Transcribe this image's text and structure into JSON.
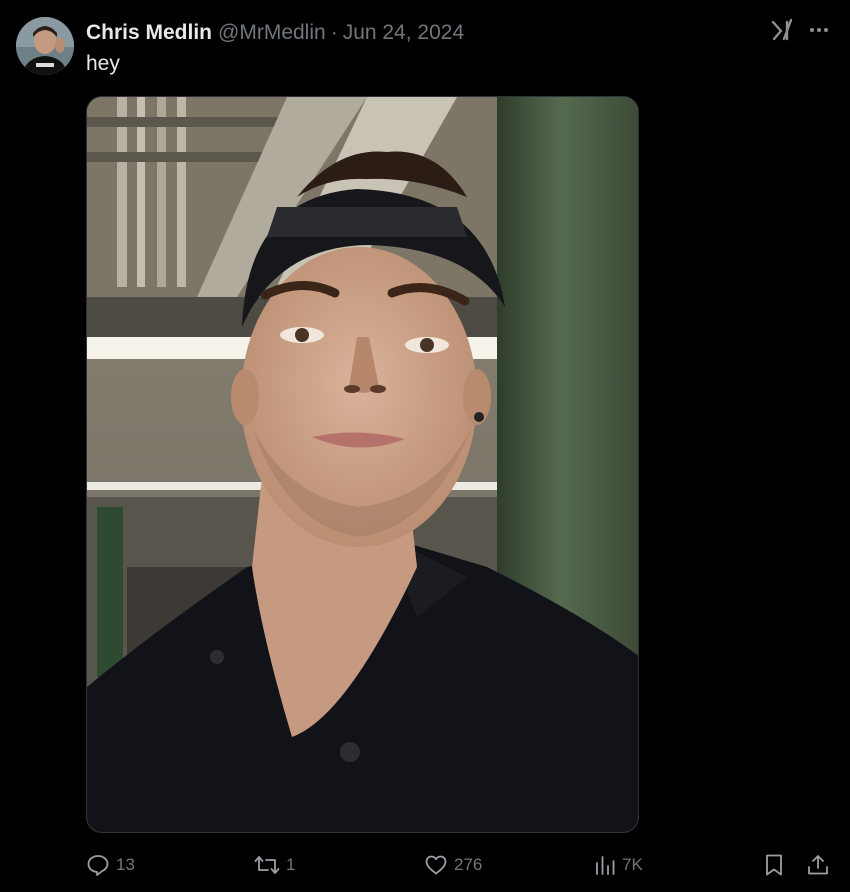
{
  "tweet": {
    "author": {
      "display_name": "Chris Medlin",
      "handle": "@MrMedlin",
      "separator": "·",
      "date": "Jun 24, 2024",
      "avatar_icon": "user-avatar"
    },
    "text": "hey",
    "media": {
      "type": "photo",
      "description_icon": "selfie-photo"
    },
    "top_icons": [
      "grok-icon",
      "more-icon"
    ],
    "actions": {
      "reply_count": "13",
      "retweet_count": "1",
      "like_count": "276",
      "views_count": "7K"
    }
  },
  "colors": {
    "background": "#000000",
    "primary_text": "#e7e9ea",
    "secondary_text": "#71767b",
    "border": "#2f3336"
  }
}
